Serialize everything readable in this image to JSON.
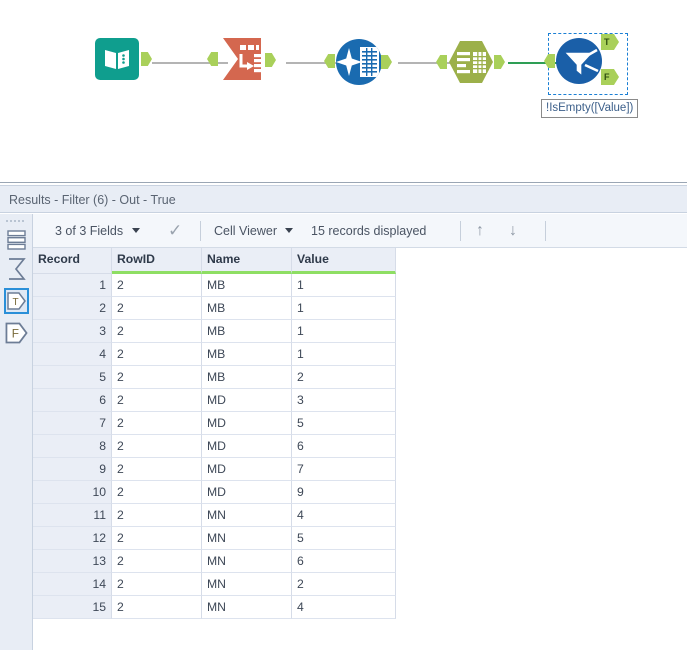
{
  "workflow": {
    "tools": [
      {
        "id": "input-data",
        "icon": "input-data-icon",
        "label": "Input Data"
      },
      {
        "id": "transpose",
        "icon": "transpose-icon",
        "label": "Transpose"
      },
      {
        "id": "data-cleansing",
        "icon": "data-cleansing-icon",
        "label": "Data Cleansing"
      },
      {
        "id": "select",
        "icon": "select-icon",
        "label": "Select"
      },
      {
        "id": "filter",
        "icon": "filter-icon",
        "label": "Filter"
      }
    ],
    "filter": {
      "annotation": "!IsEmpty([Value])",
      "true_port_label": "T",
      "false_port_label": "F",
      "selected": true
    },
    "colors": {
      "input": "#0f9e8e",
      "transpose": "#d4674f",
      "cleansing": "#1a6bb0",
      "select": "#9cb04a",
      "filter": "#1a5fa8",
      "port": "#a9d05a",
      "wire": "#b4b4b4",
      "wire_active": "#2e9e55",
      "selection": "#1a7fd4"
    }
  },
  "results": {
    "title": "Results - Filter (6) - Out - True",
    "rail": [
      {
        "name": "records-icon",
        "glyph": "records"
      },
      {
        "name": "summary-sigma-icon",
        "glyph": "sigma"
      },
      {
        "name": "true-output-icon",
        "glyph": "T",
        "selected": true
      },
      {
        "name": "false-output-icon",
        "glyph": "F",
        "selected": false
      }
    ],
    "toolbar": {
      "fields_label": "3 of 3 Fields",
      "viewer_label": "Cell Viewer",
      "records_label": "15 records displayed",
      "up_arrow": "↑",
      "down_arrow": "↓",
      "check_mark": "✓"
    },
    "table": {
      "columns": [
        "Record",
        "RowID",
        "Name",
        "Value"
      ],
      "rows": [
        [
          "1",
          "2",
          "MB",
          "1"
        ],
        [
          "2",
          "2",
          "MB",
          "1"
        ],
        [
          "3",
          "2",
          "MB",
          "1"
        ],
        [
          "4",
          "2",
          "MB",
          "1"
        ],
        [
          "5",
          "2",
          "MB",
          "2"
        ],
        [
          "6",
          "2",
          "MD",
          "3"
        ],
        [
          "7",
          "2",
          "MD",
          "5"
        ],
        [
          "8",
          "2",
          "MD",
          "6"
        ],
        [
          "9",
          "2",
          "MD",
          "7"
        ],
        [
          "10",
          "2",
          "MD",
          "9"
        ],
        [
          "11",
          "2",
          "MN",
          "4"
        ],
        [
          "12",
          "2",
          "MN",
          "5"
        ],
        [
          "13",
          "2",
          "MN",
          "6"
        ],
        [
          "14",
          "2",
          "MN",
          "2"
        ],
        [
          "15",
          "2",
          "MN",
          "4"
        ]
      ]
    }
  }
}
